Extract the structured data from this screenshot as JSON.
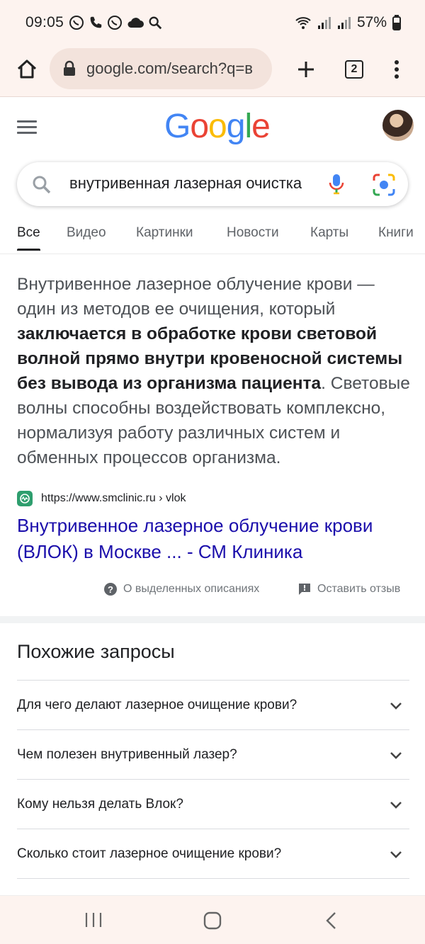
{
  "status_bar": {
    "time": "09:05",
    "battery": "57%",
    "icons_left": [
      "whatsapp-icon",
      "phone-icon",
      "whatsapp-icon",
      "cloud-icon",
      "search-icon"
    ],
    "icons_right": [
      "wifi-icon",
      "signal-icon",
      "signal-icon",
      "battery-icon"
    ]
  },
  "browser": {
    "url": "google.com/search?q=в",
    "tab_count": "2"
  },
  "google": {
    "logo": [
      "G",
      "o",
      "o",
      "g",
      "l",
      "e"
    ],
    "logo_colors": [
      "#4285F4",
      "#EA4335",
      "#FBBC05",
      "#4285F4",
      "#34A853",
      "#EA4335"
    ],
    "query": "внутривенная лазерная очистка"
  },
  "tabs": [
    {
      "label": "Все",
      "active": true
    },
    {
      "label": "Видео"
    },
    {
      "label": "Картинки"
    },
    {
      "label": "Новости"
    },
    {
      "label": "Карты"
    },
    {
      "label": "Книги"
    }
  ],
  "snippet": {
    "part1": "Внутривенное лазерное облучение крови — один из методов ее очищения, который ",
    "bold": "заключается в обработке крови световой волной прямо внутри кровеносной системы без вывода из организма пациента",
    "part2": ". Световые волны способны воздействовать комплексно, нормализуя работу различных систем и обменных процессов организма."
  },
  "result": {
    "url": "https://www.smclinic.ru › vlok",
    "title": "Внутривенное лазерное облучение крови (ВЛОК) в Москве ... - СМ Клиника"
  },
  "feedback": {
    "about": "О выделенных описаниях",
    "leave": "Оставить отзыв"
  },
  "related": {
    "title": "Похожие запросы",
    "items": [
      "Для чего делают лазерное очищение крови?",
      "Чем полезен внутривенный лазер?",
      "Кому нельзя делать Влок?",
      "Сколько стоит лазерное очищение крови?"
    ]
  },
  "colors": {
    "accent_link": "#1a0dab",
    "chrome_bg": "#fdf3ef",
    "favicon": "#2e9e6e"
  }
}
